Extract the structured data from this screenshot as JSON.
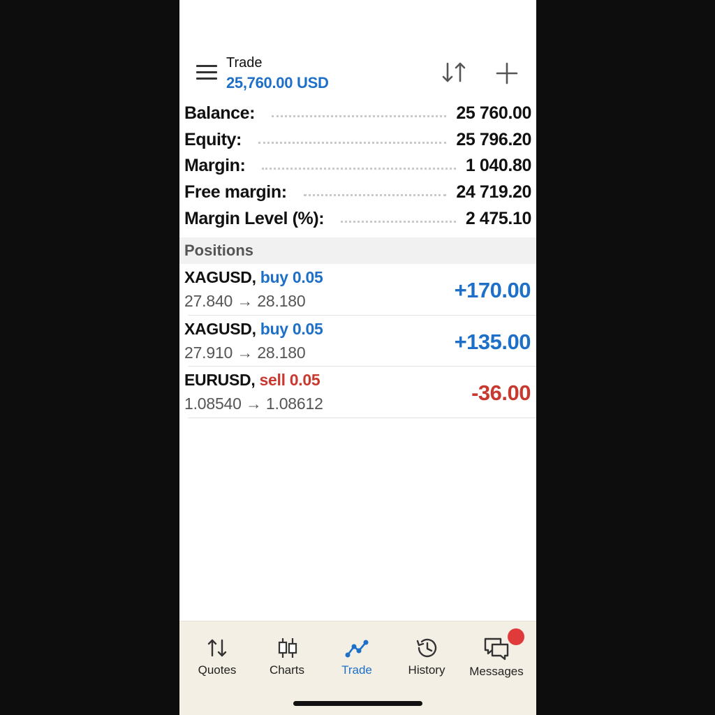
{
  "header": {
    "title": "Trade",
    "balance": "25,760.00 USD"
  },
  "summary": [
    {
      "label": "Balance:",
      "value": "25 760.00"
    },
    {
      "label": "Equity:",
      "value": "25 796.20"
    },
    {
      "label": "Margin:",
      "value": "1 040.80"
    },
    {
      "label": "Free margin:",
      "value": "24 719.20"
    },
    {
      "label": "Margin Level (%):",
      "value": "2 475.10"
    }
  ],
  "positions_header": "Positions",
  "positions": [
    {
      "symbol": "XAGUSD,",
      "direction": "buy 0.05",
      "prices": "27.840 → 28.180",
      "profit": "+170.00"
    },
    {
      "symbol": "XAGUSD,",
      "direction": "buy 0.05",
      "prices": "27.910 → 28.180",
      "profit": "+135.00"
    },
    {
      "symbol": "EURUSD,",
      "direction": "sell 0.05",
      "prices": "1.08540 → 1.08612",
      "profit": "-36.00"
    }
  ],
  "tabs": [
    {
      "label": "Quotes",
      "icon": "quotes-icon"
    },
    {
      "label": "Charts",
      "icon": "charts-icon"
    },
    {
      "label": "Trade",
      "icon": "trade-icon",
      "active": true
    },
    {
      "label": "History",
      "icon": "history-icon"
    },
    {
      "label": "Messages",
      "icon": "messages-icon",
      "badge": true
    }
  ],
  "colors": {
    "accent": "#1d6fc7",
    "negative": "#c8392f",
    "tabbar_bg": "#f4efe4",
    "badge": "#e13a3a"
  }
}
